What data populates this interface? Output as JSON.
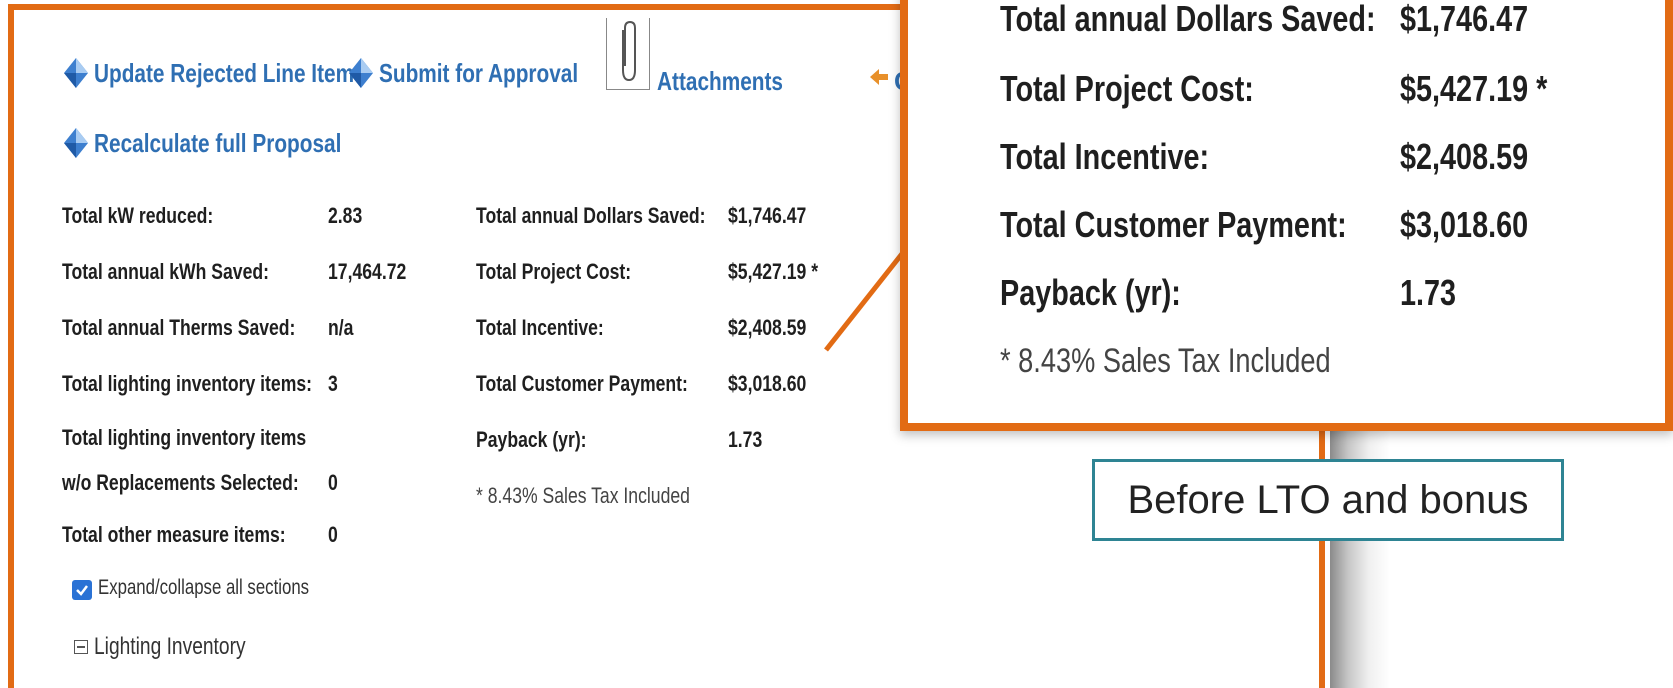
{
  "actions": {
    "update_rejected": "Update Rejected Line Items",
    "submit_for_approval": "Submit for Approval",
    "attachments": "Attachments",
    "back_letter": "C",
    "recalculate": "Recalculate full Proposal"
  },
  "summary": {
    "left": [
      {
        "label": "Total kW reduced:",
        "value": "2.83"
      },
      {
        "label": "Total annual kWh Saved:",
        "value": "17,464.72"
      },
      {
        "label": "Total annual Therms Saved:",
        "value": "n/a"
      },
      {
        "label": "Total lighting inventory items:",
        "value": "3"
      },
      {
        "label": "Total lighting inventory items",
        "label2": "w/o Replacements Selected:",
        "value": "0"
      },
      {
        "label": "Total other measure items:",
        "value": "0"
      }
    ],
    "right": [
      {
        "label": "Total annual Dollars Saved:",
        "value": "$1,746.47"
      },
      {
        "label": "Total Project Cost:",
        "value": "$5,427.19 *"
      },
      {
        "label": "Total Incentive:",
        "value": "$2,408.59"
      },
      {
        "label": "Total Customer Payment:",
        "value": "$3,018.60"
      },
      {
        "label": "Payback (yr):",
        "value": "1.73"
      }
    ],
    "tax_note": "* 8.43% Sales Tax Included"
  },
  "expand_collapse": {
    "label": "Expand/collapse all sections",
    "checked": true
  },
  "tree": {
    "lighting_inventory": "Lighting Inventory"
  },
  "zoom": {
    "rows": [
      {
        "label": "Total annual Dollars Saved:",
        "value": "$1,746.47"
      },
      {
        "label": "Total Project Cost:",
        "value": "$5,427.19 *"
      },
      {
        "label": "Total Incentive:",
        "value": "$2,408.59"
      },
      {
        "label": "Total Customer Payment:",
        "value": "$3,018.60"
      },
      {
        "label": "Payback (yr):",
        "value": "1.73"
      }
    ],
    "tax_note": "* 8.43% Sales Tax Included"
  },
  "caption": "Before LTO and bonus",
  "colors": {
    "highlight_border": "#e26b14",
    "caption_border": "#2e8493",
    "link": "#2f6fb3",
    "checkbox": "#2a72d5"
  },
  "icons": [
    "diamond-icon",
    "paperclip-icon",
    "back-arrow-icon",
    "checkmark-icon",
    "collapse-icon"
  ]
}
